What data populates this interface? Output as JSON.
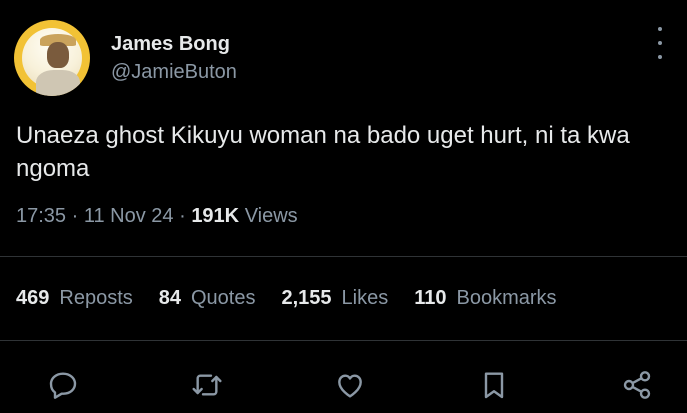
{
  "author": {
    "name": "James Bong",
    "handle": "@JamieButon"
  },
  "tweet": {
    "text": "Unaeza ghost Kikuyu woman na bado uget hurt, ni ta kwa ngoma",
    "time": "17:35",
    "date": "11 Nov 24",
    "views_count": "191K",
    "views_label": "Views"
  },
  "stats": [
    {
      "count": "469",
      "label": "Reposts"
    },
    {
      "count": "84",
      "label": "Quotes"
    },
    {
      "count": "2,155",
      "label": "Likes"
    },
    {
      "count": "110",
      "label": "Bookmarks"
    }
  ],
  "actions": [
    "reply-icon",
    "repost-icon",
    "like-icon",
    "bookmark-icon",
    "share-icon"
  ],
  "colors": {
    "background": "#000000",
    "text": "#e7e9ea",
    "secondary": "#8b98a5",
    "divider": "#2f3336",
    "avatar_ring": "#f2c235"
  }
}
